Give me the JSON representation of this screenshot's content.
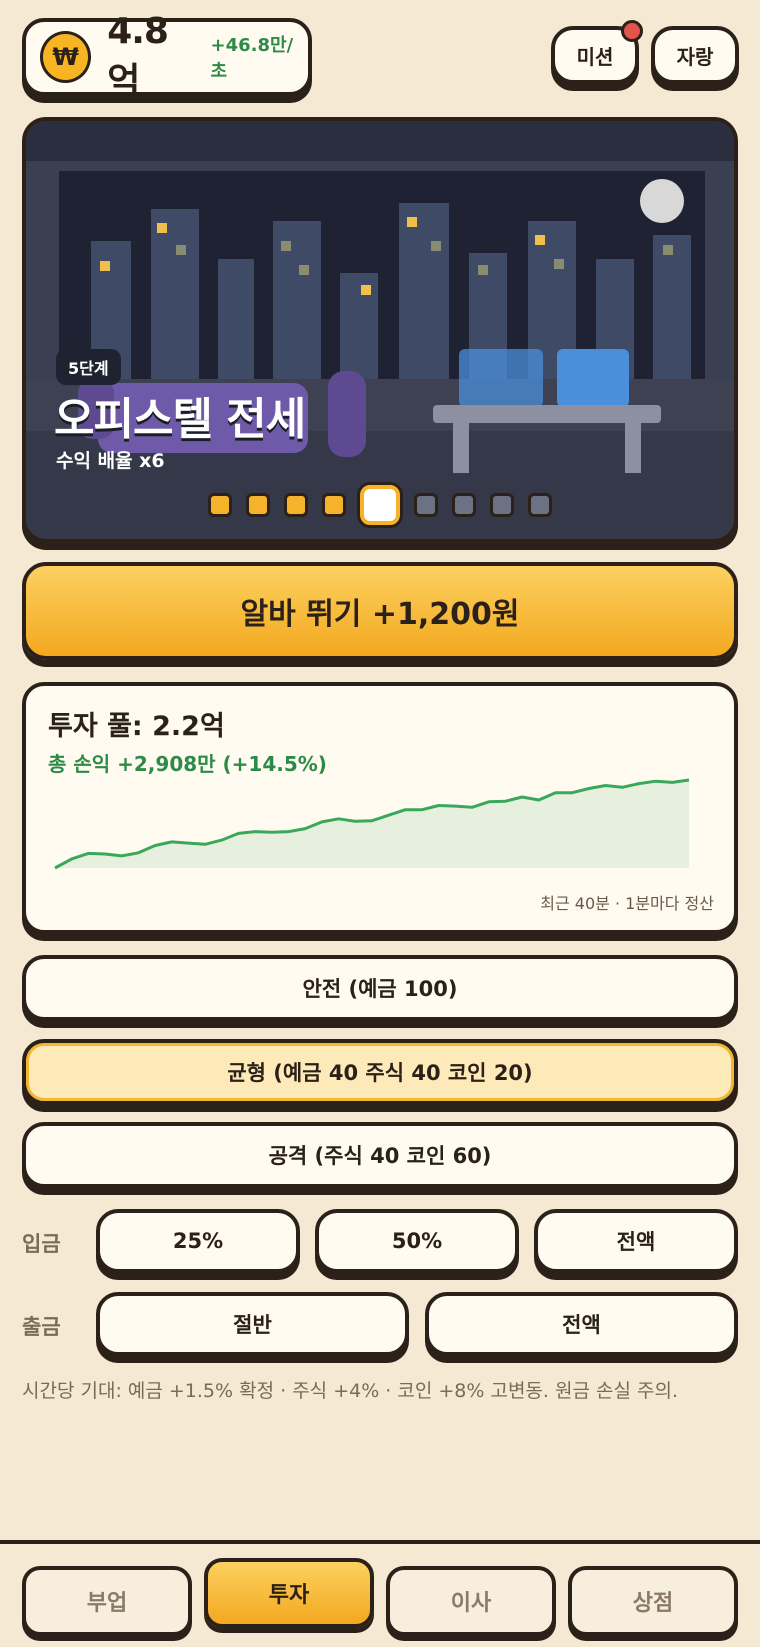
{
  "header": {
    "coin_symbol": "₩",
    "money": "4.8억",
    "rate": "+46.8만/초",
    "mission_label": "미션",
    "brag_label": "자랑"
  },
  "scene": {
    "stage_badge": "5단계",
    "stage_name": "오피스텔 전세",
    "multiplier": "수익 배율 x6",
    "stage_progress": {
      "current": 5,
      "total": 9
    }
  },
  "work_button": {
    "label": "알바 뛰기 +1,200원"
  },
  "invest": {
    "pool": "투자 풀: 2.2억",
    "profit": "총 손익 +2,908만 (+14.5%)",
    "note": "최근 40분 · 1분마다 정산",
    "chart_data": {
      "type": "area",
      "values": [
        0,
        1.5,
        2.4,
        2.3,
        2.0,
        2.5,
        3.7,
        4.3,
        4.1,
        3.9,
        4.6,
        5.7,
        6.0,
        5.9,
        6.0,
        6.5,
        7.6,
        8.1,
        7.7,
        7.8,
        8.7,
        9.6,
        9.6,
        10.3,
        10.2,
        10.0,
        10.9,
        11.0,
        11.7,
        11.2,
        12.4,
        12.4,
        13.1,
        13.6,
        13.3,
        13.9,
        14.3,
        14.1,
        14.5
      ],
      "color": "#3aa85a"
    }
  },
  "strategies": [
    {
      "label": "안전 (예금 100)",
      "active": false
    },
    {
      "label": "균형 (예금 40 주식 40 코인 20)",
      "active": true
    },
    {
      "label": "공격 (주식 40 코인 60)",
      "active": false
    }
  ],
  "deposit": {
    "label": "입금",
    "options": [
      "25%",
      "50%",
      "전액"
    ]
  },
  "withdraw": {
    "label": "출금",
    "options": [
      "절반",
      "전액"
    ]
  },
  "hint": "시간당 기대: 예금 +1.5% 확정 · 주식 +4% · 코인 +8% 고변동. 원금 손실 주의.",
  "nav": [
    {
      "label": "부업",
      "active": false
    },
    {
      "label": "투자",
      "active": true
    },
    {
      "label": "이사",
      "active": false
    },
    {
      "label": "상점",
      "active": false
    }
  ]
}
